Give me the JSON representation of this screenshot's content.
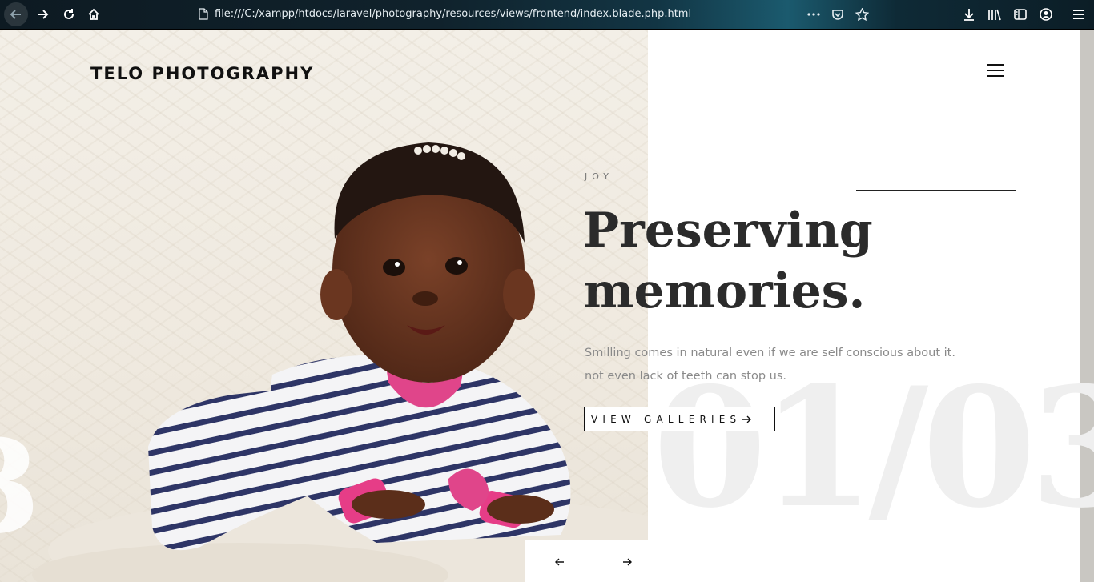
{
  "browser": {
    "url": "file:///C:/xampp/htdocs/laravel/photography/resources/views/frontend/index.blade.php.html",
    "icons": [
      "back-icon",
      "forward-icon",
      "reload-icon",
      "home-icon",
      "page-icon",
      "more-icon",
      "pocket-icon",
      "bookmark-star-icon",
      "download-icon",
      "library-icon",
      "sidebar-icon",
      "account-icon",
      "menu-icon"
    ]
  },
  "site": {
    "brand": "TELO PHOTOGRAPHY"
  },
  "hero": {
    "eyebrow": "JOY",
    "headline_line1": "Preserving",
    "headline_line2": "memories.",
    "subtext_line1": "Smilling comes in natural even if we are self conscious about it.",
    "subtext_line2": "not even lack of teeth can stop us.",
    "cta_label": "VIEW GALLERIES",
    "counter": "01/03"
  },
  "colors": {
    "headline": "#2b2b2b",
    "body_text": "#8a8a8a",
    "counter_ghost": "#efefef"
  }
}
